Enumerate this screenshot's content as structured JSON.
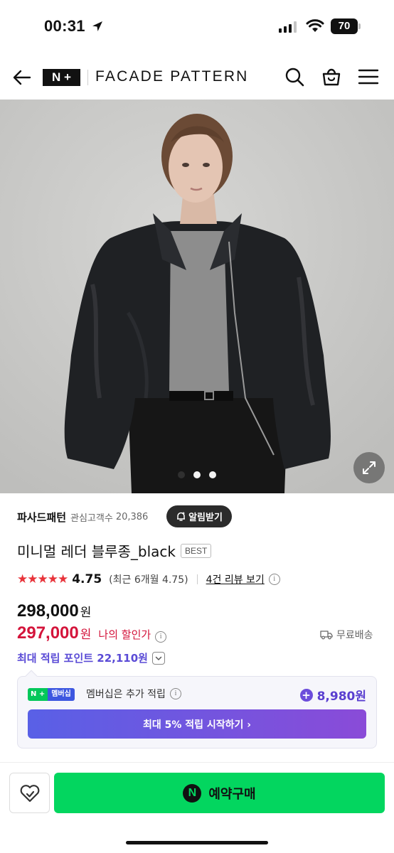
{
  "status_bar": {
    "time": "00:31",
    "battery": "70"
  },
  "header": {
    "logo_text": "N+",
    "brand": "FACADE PATTERN"
  },
  "hero": {
    "slides_total": 3,
    "active_slide": 2
  },
  "store": {
    "name": "파사드패턴",
    "followers_label": "관심고객수",
    "followers_count": "20,386",
    "alarm_label": "알림받기"
  },
  "product": {
    "title": "미니멀 레더 블루종_black",
    "badge": "BEST"
  },
  "rating": {
    "stars": "★★★★★",
    "value": "4.75",
    "recent": "(최근 6개월 4.75)",
    "review_link": "4건 리뷰 보기",
    "info": "i"
  },
  "price": {
    "original": "298,000",
    "original_unit": "원",
    "sale": "297,000",
    "sale_unit": "원",
    "sale_label": "나의 할인가",
    "shipping": "무료배송"
  },
  "points": {
    "label": "최대 적립 포인트 22,110원"
  },
  "membership": {
    "badge_left": "N +",
    "badge_right": "멤버십",
    "text": "멤버십은 추가 적립",
    "points": "8,980원",
    "cta": "최대 5% 적립 시작하기 ›"
  },
  "bottom": {
    "buy_label": "예약구매",
    "buy_icon_letter": "N"
  },
  "colors": {
    "sale_red": "#d4143b",
    "points_purple": "#5a4bd6",
    "buy_green": "#03d65f",
    "star_red": "#e8333a"
  }
}
